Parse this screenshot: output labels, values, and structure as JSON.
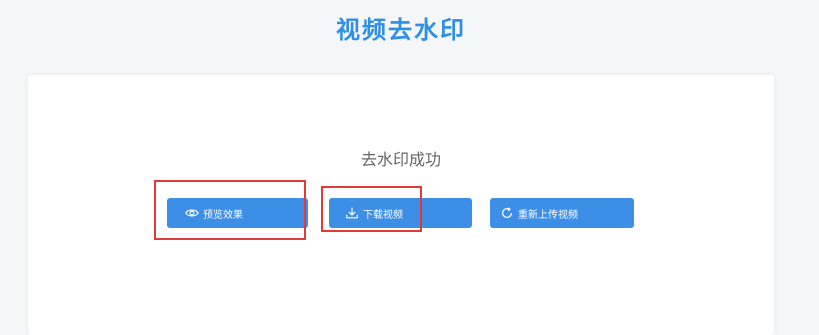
{
  "header": {
    "title": "视频去水印"
  },
  "status": {
    "message": "去水印成功"
  },
  "actions": {
    "preview_label": "预览效果",
    "download_label": "下载视频",
    "reupload_label": "重新上传视频"
  },
  "icons": {
    "preview": "eye-icon",
    "download": "download-icon",
    "reupload": "refresh-icon"
  },
  "colors": {
    "title": "#2e8fe6",
    "button": "#3d8ee6",
    "annotation": "#e03a3a"
  }
}
